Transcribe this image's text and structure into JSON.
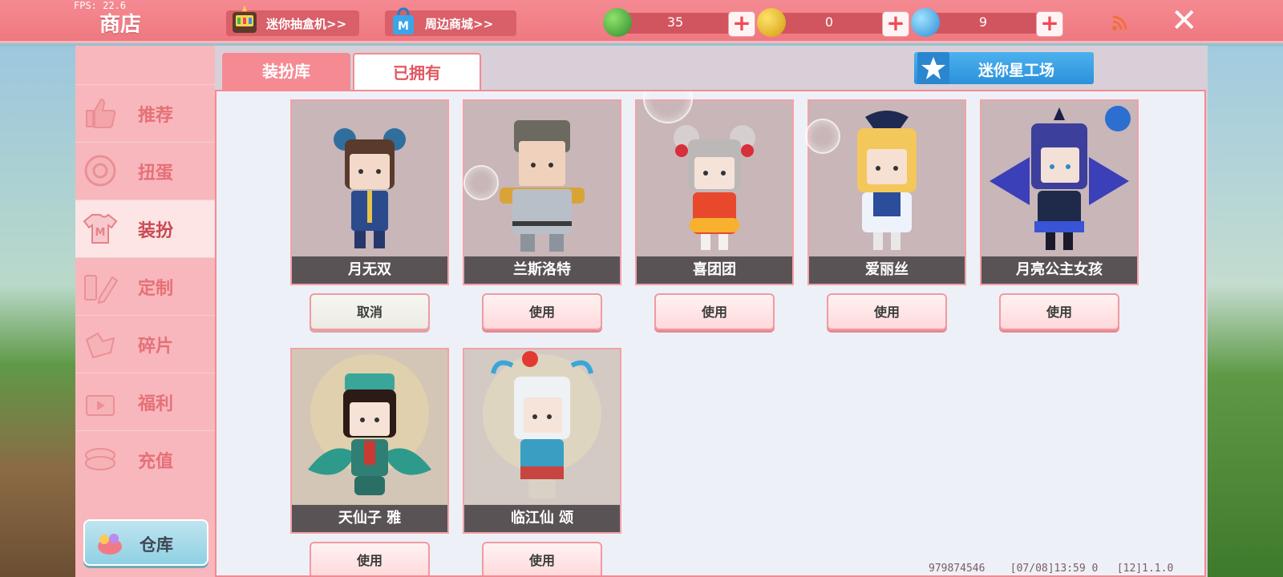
{
  "app": {
    "fps": "FPS: 22.6",
    "title": "商店"
  },
  "top_links": {
    "blindbox": "迷你抽盒机>>",
    "merch": "周边商城>>"
  },
  "currencies": [
    {
      "icon": "green-gem-icon",
      "value": "35"
    },
    {
      "icon": "gold-coin-icon",
      "value": "0"
    },
    {
      "icon": "blue-coin-icon",
      "value": "9"
    }
  ],
  "sidebar": {
    "items": [
      {
        "label": "推荐",
        "icon": "thumbs-up-icon"
      },
      {
        "label": "扭蛋",
        "icon": "capsule-icon"
      },
      {
        "label": "装扮",
        "icon": "shirt-icon",
        "active": true
      },
      {
        "label": "定制",
        "icon": "pencil-ruler-icon"
      },
      {
        "label": "碎片",
        "icon": "fragment-icon"
      },
      {
        "label": "福利",
        "icon": "gift-icon"
      },
      {
        "label": "充值",
        "icon": "coins-icon"
      }
    ],
    "warehouse": "仓库"
  },
  "tabs": {
    "wardrobe": "装扮库",
    "owned": "已拥有"
  },
  "workshop": "迷你星工场",
  "skins": [
    {
      "name": "月无双",
      "action": "取消"
    },
    {
      "name": "兰斯洛特",
      "action": "使用"
    },
    {
      "name": "喜团团",
      "action": "使用"
    },
    {
      "name": "爱丽丝",
      "action": "使用"
    },
    {
      "name": "月亮公主女孩",
      "action": "使用"
    },
    {
      "name": "天仙子 雅",
      "action": "使用"
    },
    {
      "name": "临江仙 颂",
      "action": "使用"
    }
  ],
  "footer": {
    "uid": "979874546",
    "time": "[07/08]13:59 0",
    "version": "[12]1.1.0"
  },
  "colors": {
    "accent": "#f58a92",
    "workshop": "#2b91d9"
  }
}
